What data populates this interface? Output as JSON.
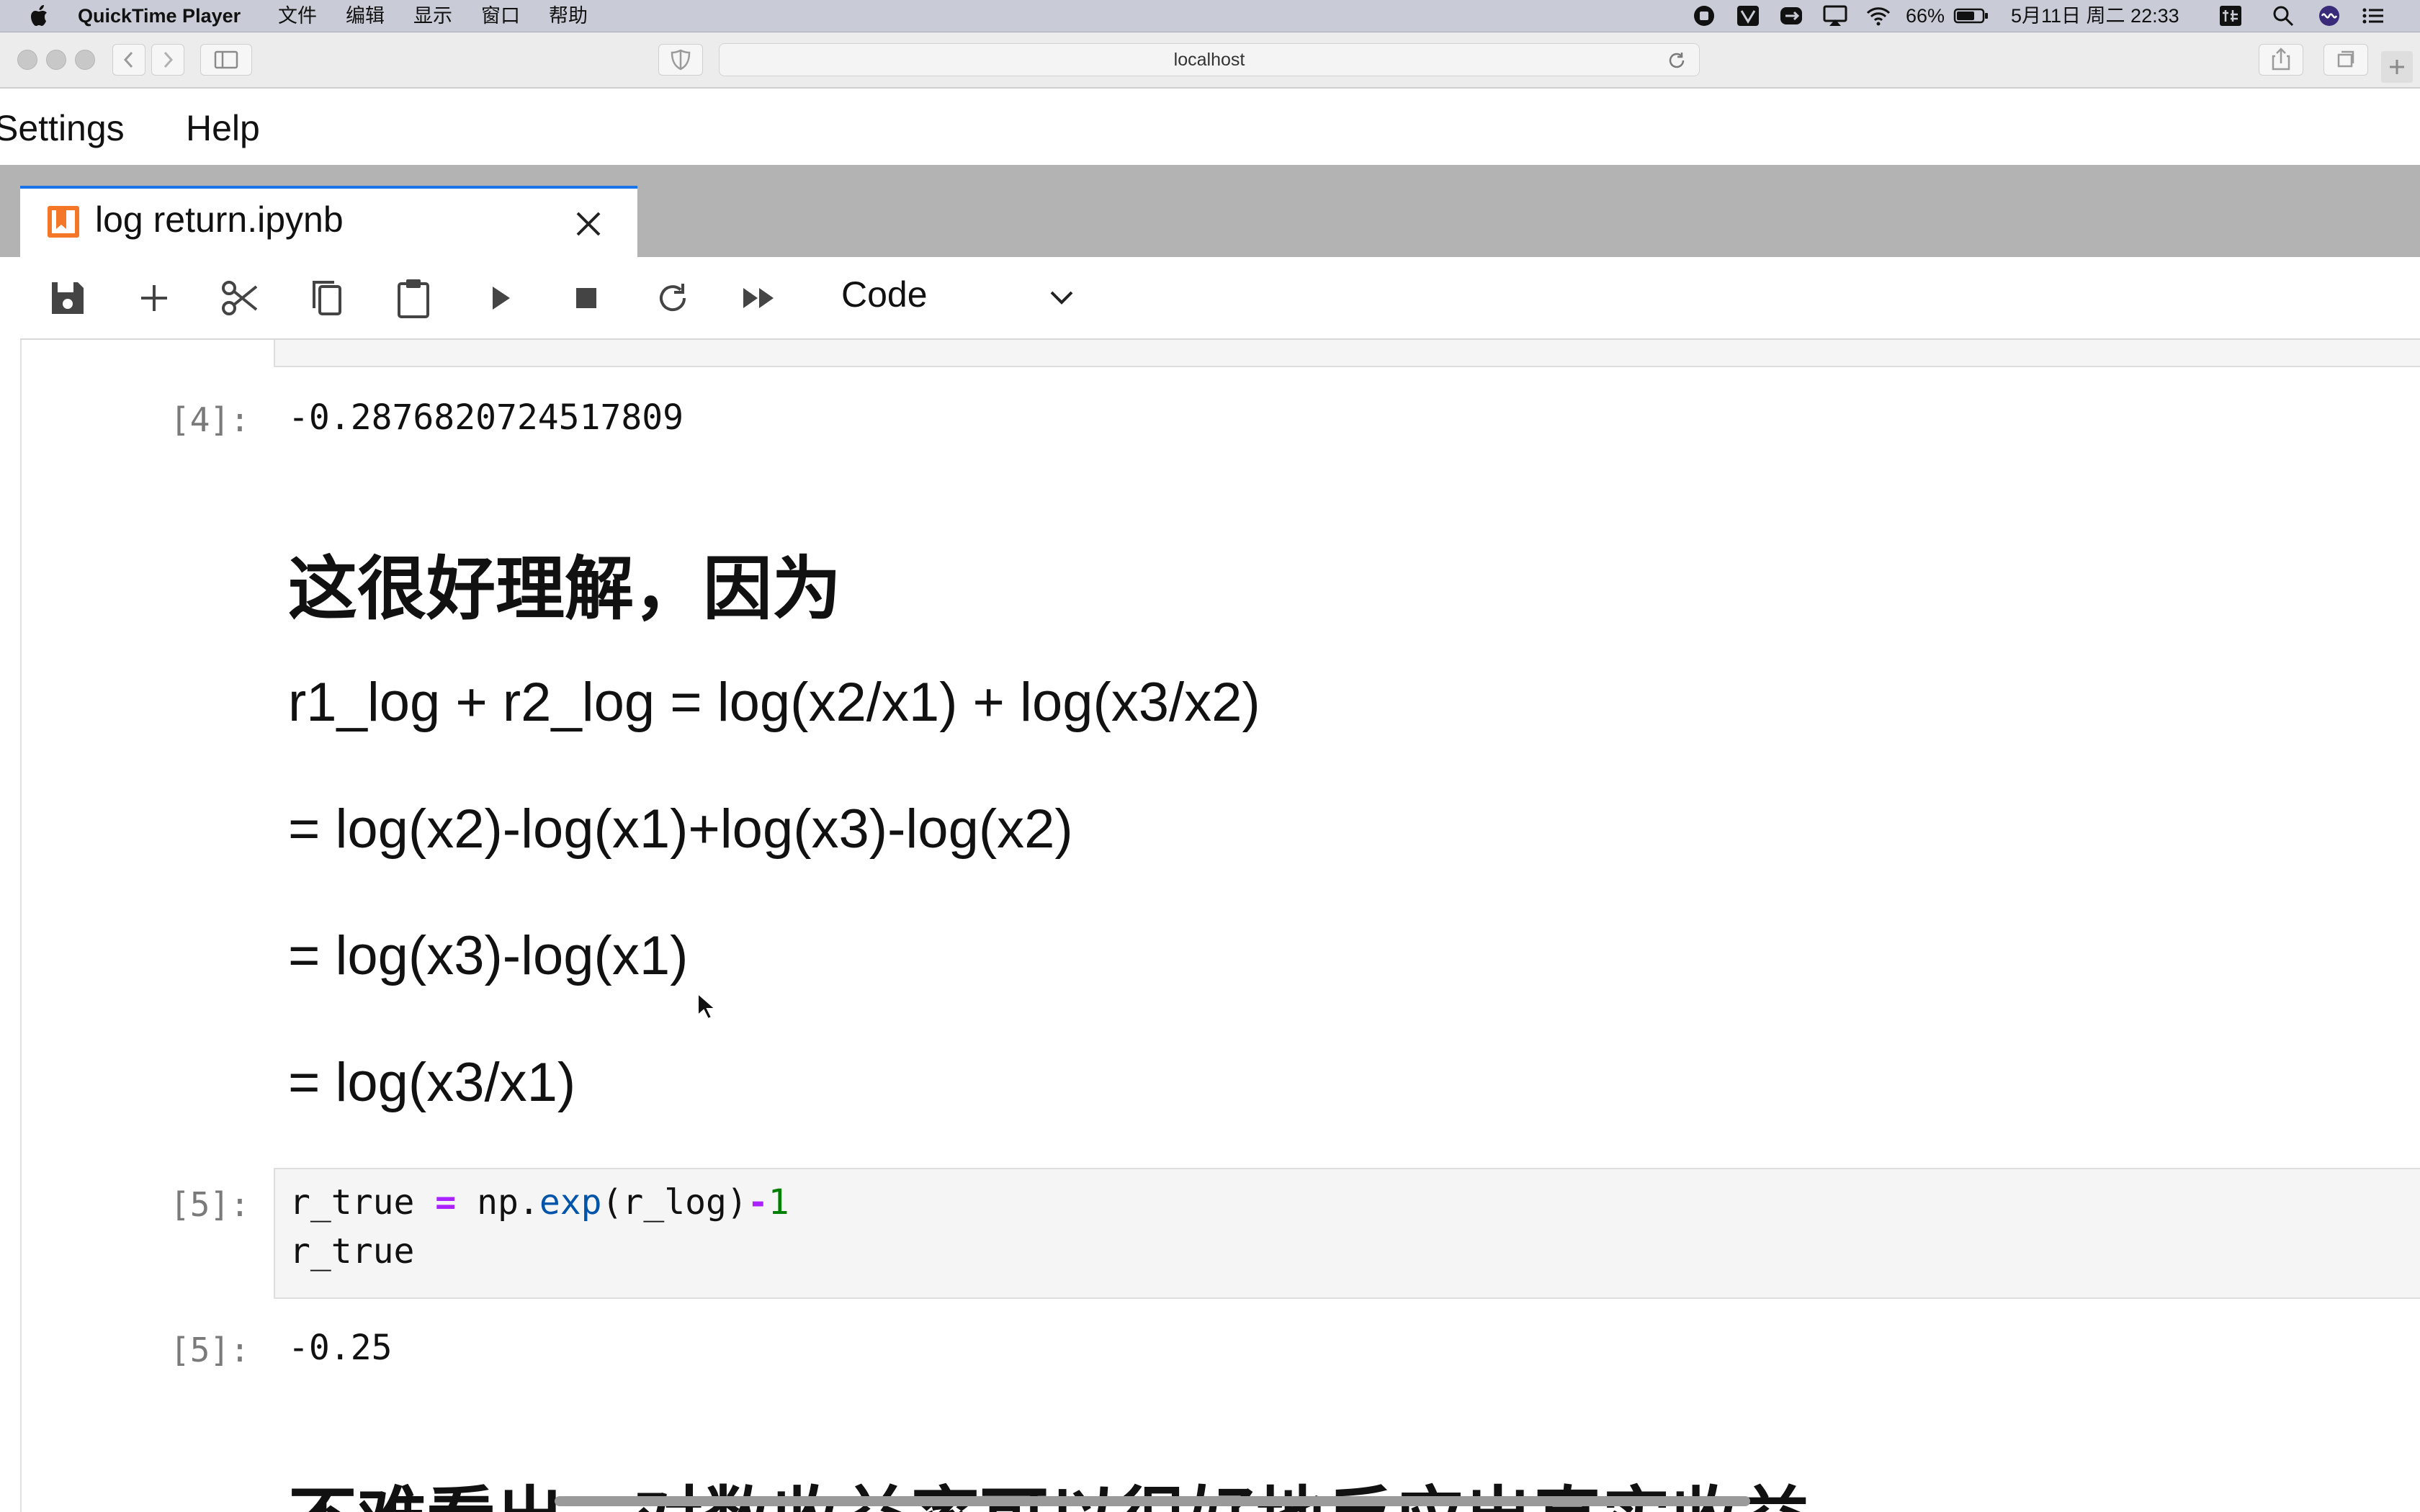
{
  "menubar": {
    "app_name": "QuickTime Player",
    "menus": [
      "文件",
      "编辑",
      "显示",
      "窗口",
      "帮助"
    ],
    "battery": "66%",
    "datetime": "5月11日 周二 22:33"
  },
  "browser": {
    "url": "localhost"
  },
  "jupyter_menu": [
    "Settings",
    "Help"
  ],
  "tab": {
    "title": "log return.ipynb"
  },
  "toolbar": {
    "cell_type": "Code"
  },
  "cells": {
    "out4_prompt": "[4]:",
    "out4_value": "-0.2876820724517809",
    "md_heading": "这很好理解，因为",
    "md_line1": "r1_log + r2_log = log(x2/x1) + log(x3/x2)",
    "md_line2": "= log(x2)-log(x1)+log(x3)-log(x2)",
    "md_line3": "= log(x3)-log(x1)",
    "md_line4": "= log(x3/x1)",
    "in5_prompt": "[5]:",
    "in5_line1": {
      "var": "r_true",
      "eq": "=",
      "obj": "np.",
      "fn": "exp",
      "args": "(r_log)",
      "op": "-",
      "num": "1"
    },
    "in5_line2": "r_true",
    "out5_prompt": "[5]:",
    "out5_value": "-0.25",
    "md_bottom": "不难看出，对数收益率可以很好地反应出真实收益"
  }
}
